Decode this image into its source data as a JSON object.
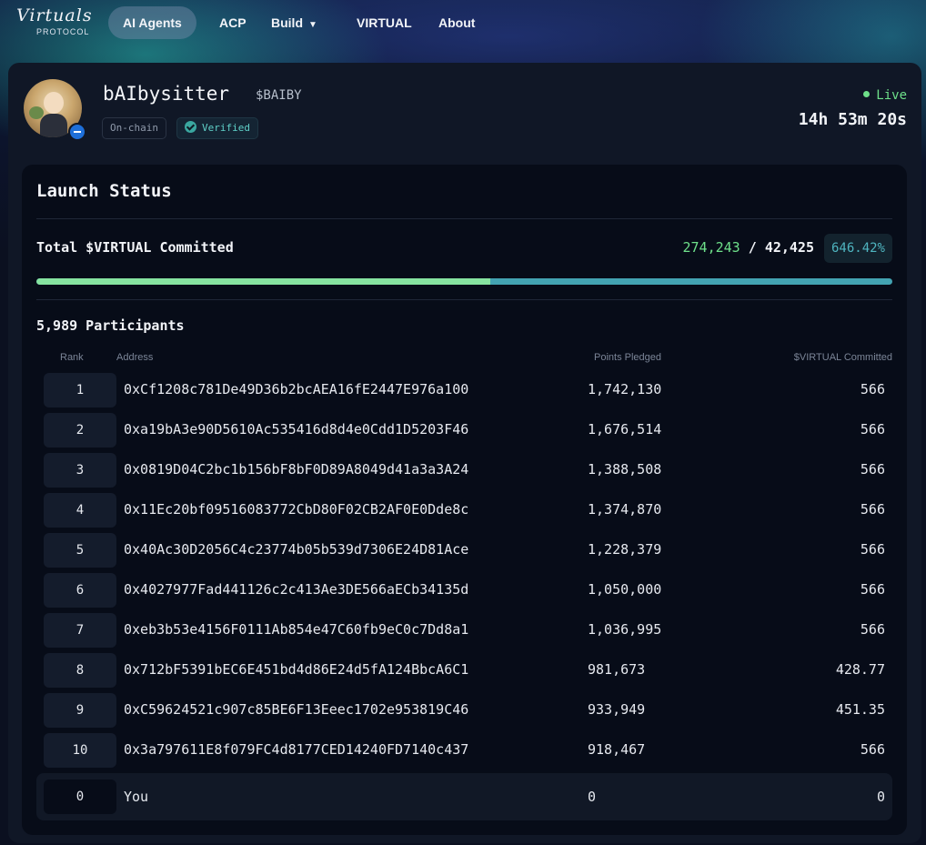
{
  "nav": {
    "logo_script": "Virtuals",
    "logo_sub": "PROTOCOL",
    "items": [
      {
        "label": "AI Agents",
        "active": true
      },
      {
        "label": "ACP"
      },
      {
        "label": "Build"
      },
      {
        "label": "VIRTUAL"
      },
      {
        "label": "About"
      }
    ]
  },
  "agent": {
    "name": "bAIbysitter",
    "ticker": "$BAIBY",
    "tags": [
      "On-chain",
      "Verified"
    ],
    "status": "Live",
    "countdown": "14h 53m 20s"
  },
  "launch": {
    "title": "Launch Status",
    "committed_label": "Total $VIRTUAL Committed",
    "committed": "274,243",
    "separator": "/",
    "target": "42,425",
    "percent": "646.42%",
    "progress_fraction": 0.53,
    "participants": "5,989 Participants",
    "columns": [
      "Rank",
      "Address",
      "Points Pledged",
      "$VIRTUAL Committed"
    ],
    "rows": [
      {
        "rank": "1",
        "address": "0xCf1208c781De49D36b2bcAEA16fE2447E976a100",
        "points": "1,742,130",
        "committed": "566"
      },
      {
        "rank": "2",
        "address": "0xa19bA3e90D5610Ac535416d8d4e0Cdd1D5203F46",
        "points": "1,676,514",
        "committed": "566"
      },
      {
        "rank": "3",
        "address": "0x0819D04C2bc1b156bF8bF0D89A8049d41a3a3A24",
        "points": "1,388,508",
        "committed": "566"
      },
      {
        "rank": "4",
        "address": "0x11Ec20bf09516083772CbD80F02CB2AF0E0Dde8c",
        "points": "1,374,870",
        "committed": "566"
      },
      {
        "rank": "5",
        "address": "0x40Ac30D2056C4c23774b05b539d7306E24D81Ace",
        "points": "1,228,379",
        "committed": "566"
      },
      {
        "rank": "6",
        "address": "0x4027977Fad441126c2c413Ae3DE566aECb34135d",
        "points": "1,050,000",
        "committed": "566"
      },
      {
        "rank": "7",
        "address": "0xeb3b53e4156F0111Ab854e47C60fb9eC0c7Dd8a1",
        "points": "1,036,995",
        "committed": "566"
      },
      {
        "rank": "8",
        "address": "0x712bF5391bEC6E451bd4d86E24d5fA124BbcA6C1",
        "points": "981,673",
        "committed": "428.77"
      },
      {
        "rank": "9",
        "address": "0xC59624521c907c85BE6F13Eeec1702e953819C46",
        "points": "933,949",
        "committed": "451.35"
      },
      {
        "rank": "10",
        "address": "0x3a797611E8f079FC4d8177CED14240FD7140c437",
        "points": "918,467",
        "committed": "566"
      }
    ],
    "you": {
      "rank": "0",
      "address": "You",
      "points": "0",
      "committed": "0"
    }
  }
}
